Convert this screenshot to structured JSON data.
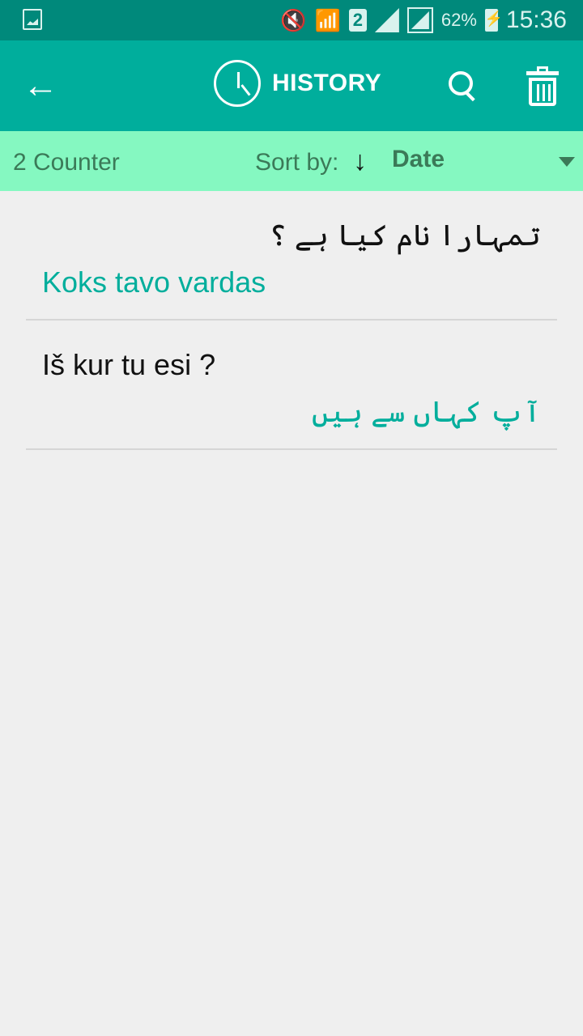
{
  "status_bar": {
    "icons": [
      "gallery-icon",
      "mute-vibrate-icon",
      "wifi-icon",
      "sim2-icon",
      "signal-icon",
      "signal-icon"
    ],
    "sim_label": "2",
    "battery": "62%",
    "time": "15:36"
  },
  "app_bar": {
    "back_icon": "←",
    "title": "HISTORY",
    "icons": [
      "clock-icon",
      "search-icon",
      "trash-icon"
    ]
  },
  "sort_bar": {
    "counter": "2 Counter",
    "sort_label": "Sort by:",
    "sort_direction": "↓",
    "sort_value": "Date"
  },
  "history": [
    {
      "source": "تمہارا نام کیا ہے ؟",
      "source_dir": "rtl",
      "translation": "Koks tavo vardas",
      "translation_dir": "ltr"
    },
    {
      "source": "Iš kur tu esi ?",
      "source_dir": "ltr",
      "translation": "آپ کہاں سے ہیں",
      "translation_dir": "rtl"
    }
  ],
  "colors": {
    "status_bar": "#00897b",
    "app_bar": "#00ae9c",
    "sort_bar": "#85f8c1",
    "accent_text": "#00ae9c"
  }
}
